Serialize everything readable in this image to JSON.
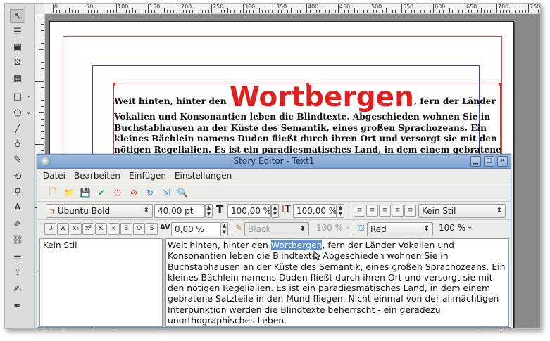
{
  "window": {
    "tools": [
      {
        "icon": "pointer-icon",
        "glyph": "↖"
      },
      {
        "icon": "text-frame-icon",
        "glyph": "☰"
      },
      {
        "icon": "image-frame-icon",
        "glyph": "▣"
      },
      {
        "icon": "render-frame-icon",
        "glyph": "⚙"
      },
      {
        "icon": "table-icon",
        "glyph": "▦"
      },
      {
        "icon": "rectangle-shape-icon",
        "glyph": "□"
      },
      {
        "icon": "polygon-icon",
        "glyph": "⬠"
      },
      {
        "icon": "line-icon",
        "glyph": "╱"
      },
      {
        "icon": "bezier-curve-icon",
        "glyph": "♁"
      },
      {
        "icon": "freehand-line-icon",
        "glyph": "✎"
      },
      {
        "icon": "rotate-item-icon",
        "glyph": "⟲"
      },
      {
        "icon": "zoom-icon",
        "glyph": "⚲"
      },
      {
        "icon": "edit-text-icon",
        "glyph": "A"
      },
      {
        "icon": "story-editor-icon",
        "glyph": "✐"
      },
      {
        "icon": "link-frames-icon",
        "glyph": "⛓"
      },
      {
        "icon": "unlink-frames-icon",
        "glyph": "⚌"
      },
      {
        "icon": "measurements-icon",
        "glyph": "⟟"
      },
      {
        "icon": "copy-properties-icon",
        "glyph": "✍"
      },
      {
        "icon": "eye-dropper-icon",
        "glyph": "✒"
      }
    ]
  },
  "ruler": {
    "labels": [
      "0",
      "50",
      "100",
      "150",
      "200",
      "250",
      "300",
      "350",
      "400",
      "450",
      "500",
      "550",
      "600",
      "650",
      "700",
      "750"
    ]
  },
  "document": {
    "text_before": "Weit hinten, hinter den ",
    "big_word": "Wortbergen",
    "text_after": ", fern der Länder Vokalien und Konsonantien leben die Blindtexte. Abgeschieden wohnen Sie in Buchstabhausen an der Küste des Semantik, eines großen Sprachozeans. Ein kleines Bächlein namens Duden fließt durch ihren Ort und versorgt sie mit den nötigen Regelialien. Es ist ein paradiesmatisches Land, in dem einem gebratene Satzteile in den Mund fliegen. Nicht einmal von der allmächtigen Interpunktion werden die Blindtexte beherrscht - ein geradezu unorthographisches Leben."
  },
  "story_editor": {
    "title": "Story Editor - Text1",
    "menu": [
      "Datei",
      "Bearbeiten",
      "Einfügen",
      "Einstellungen"
    ],
    "font_name": "Ubuntu Bold",
    "font_size": "40,00 pt",
    "scale_width": "100,00 %",
    "scale_height": "100,00 %",
    "paragraph_style": "Kein Stil",
    "tracking": "0,00 %",
    "stroke_color": "Black",
    "stroke_shade": "100 %",
    "fill_color": "Red",
    "fill_shade": "100 %",
    "style_list": [
      "Kein Stil"
    ],
    "story_before": "Weit hinten, hinter den ",
    "story_selected": "Wortbergen",
    "story_after": ", fern der Länder Vokalien und Konsonantien leben die Blindtexte. Abgeschieden wohnen Sie in Buchstabhausen an der Küste des Semantik, eines großen Sprachozeans. Ein kleines Bächlein namens Duden fließt durch ihren Ort und versorgt sie mit den nötigen Regelialien. Es ist ein paradiesmatisches Land, in dem einem gebratene Satzteile in den Mund fliegen. Nicht einmal von der allmächtigen Interpunktion werden die Blindtexte beherrscht - ein geradezu unorthographisches Leben."
  },
  "colors": {
    "accent_red": "#e02020",
    "selection": "#5f8fcf",
    "margin_guide": "#3340d9"
  }
}
